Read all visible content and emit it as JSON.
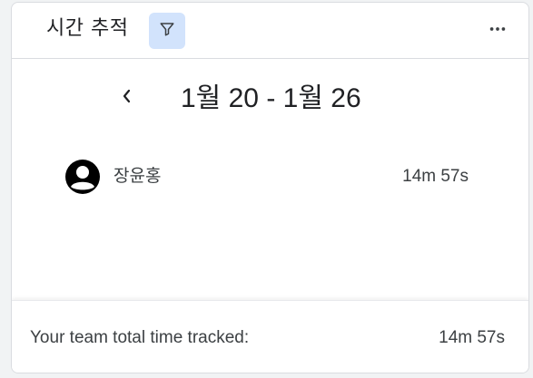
{
  "header": {
    "title": "시간 추적",
    "filter_icon": "filter-icon",
    "more_icon": "more-horizontal-icon"
  },
  "range": {
    "prev_icon": "chevron-left-icon",
    "label": "1월 20 - 1월 26"
  },
  "members": [
    {
      "avatar_icon": "account-circle-icon",
      "name": "장윤홍",
      "time": "14m 57s"
    }
  ],
  "footer": {
    "label": "Your team total time tracked:",
    "total": "14m 57s"
  },
  "colors": {
    "filter_bg": "#d2e3fc",
    "text": "#202124",
    "border": "#dadce0"
  }
}
